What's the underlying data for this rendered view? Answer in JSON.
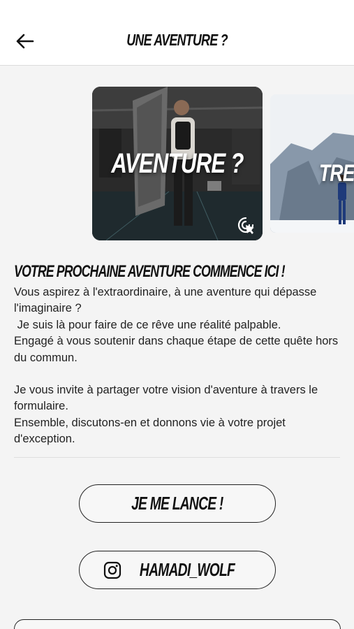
{
  "header": {
    "title": "UNE AVENTURE ?"
  },
  "carousel": {
    "cards": [
      {
        "label": "AVENTURE ?"
      },
      {
        "label": "TRE"
      }
    ]
  },
  "main": {
    "section_title": "VOTRE PROCHAINE AVENTURE COMMENCE ICI !",
    "paragraph1": [
      "Vous aspirez à l'extraordinaire, à une aventure qui dépasse l'imaginaire ?",
      " Je suis là pour faire de ce rêve une réalité palpable.",
      "Engagé à vous soutenir dans chaque étape de cette quête hors du commun."
    ],
    "paragraph2": [
      "Je vous invite à partager votre vision d'aventure à travers le formulaire.",
      "Ensemble, discutons-en et donnons vie à votre projet d'exception."
    ]
  },
  "buttons": {
    "lance_label": "JE ME LANCE !",
    "instagram_label": "HAMADI_WOLF"
  },
  "icons": {
    "back": "arrow-left-icon",
    "tap": "tap-cursor-icon",
    "instagram": "instagram-icon"
  }
}
